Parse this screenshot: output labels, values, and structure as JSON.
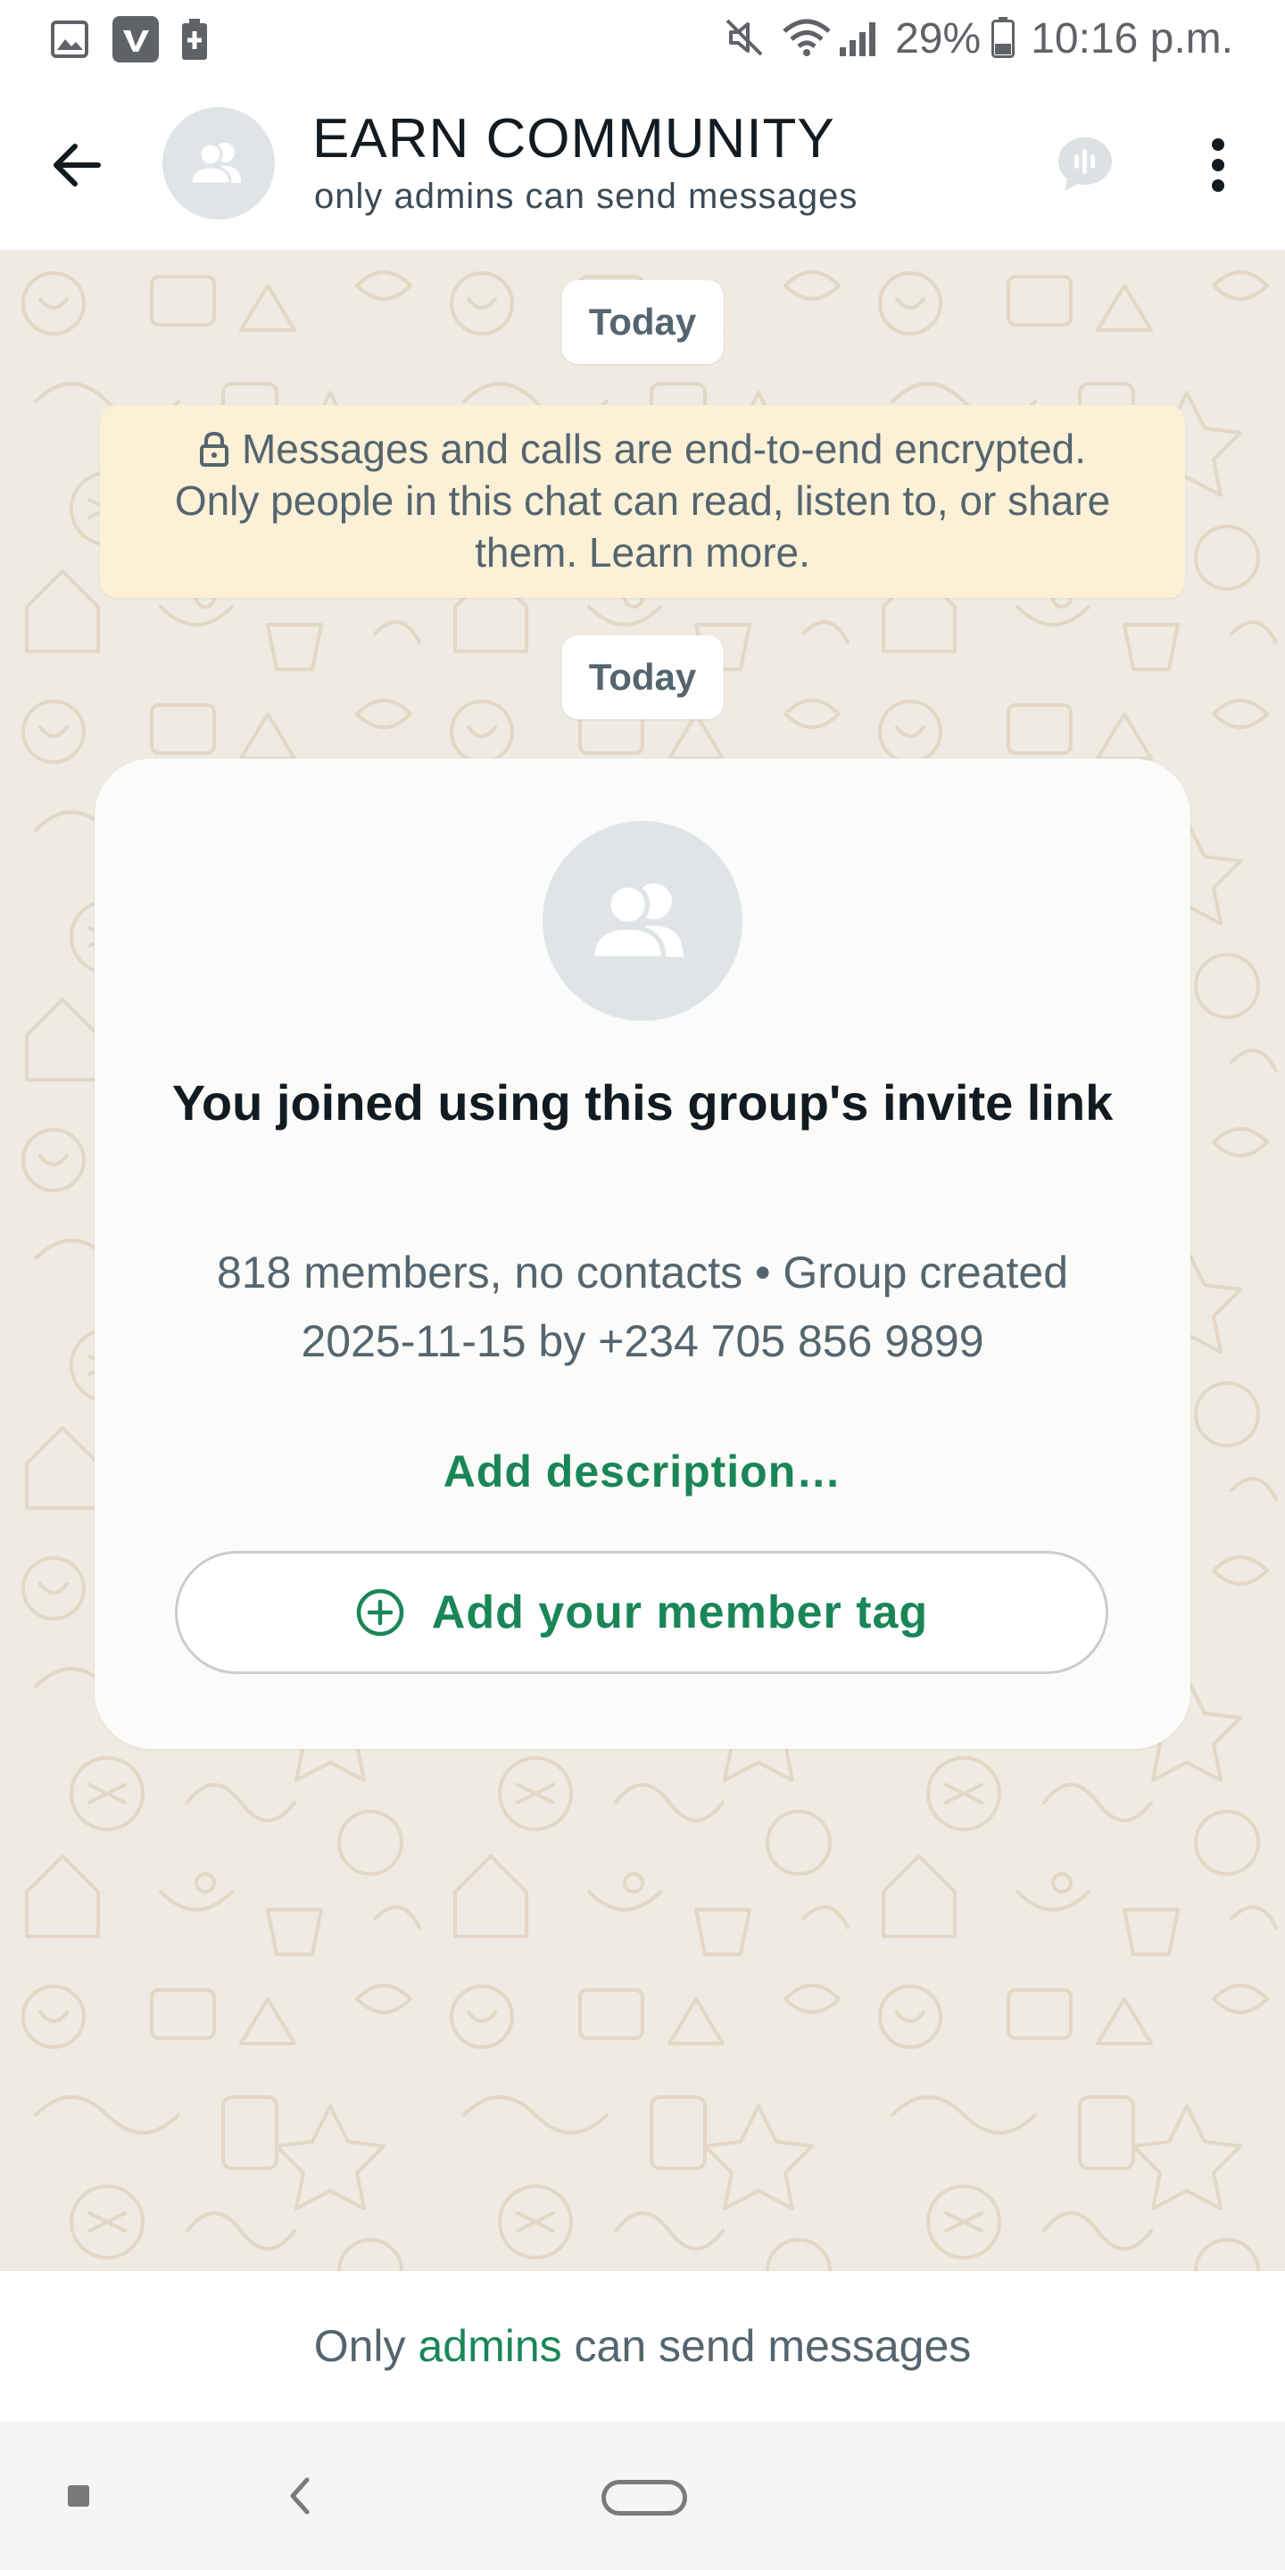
{
  "status_bar": {
    "left_icons": [
      "gallery-icon",
      "vimeo-icon",
      "battery-saver-icon"
    ],
    "right_icons": [
      "mute-icon",
      "wifi-icon",
      "signal-icon",
      "battery-icon"
    ],
    "battery_percent": "29%",
    "time": "10:16 p.m."
  },
  "header": {
    "title": "EARN COMMUNITY",
    "subtitle": "only admins can send messages",
    "icons": [
      "back-arrow-icon",
      "group-avatar-icon",
      "voice-chat-icon",
      "more-vert-icon"
    ]
  },
  "chat": {
    "date_chip_1": "Today",
    "encryption_notice": {
      "line1": "Messages and calls are end-to-end encrypted.",
      "line2": "Only people in this chat can read, listen to, or share",
      "line3": "them. Learn more."
    },
    "date_chip_2": "Today",
    "join_card": {
      "title": "You joined using this group's invite link",
      "info": "818 members, no contacts • Group created 2025-11-15 by +234 705 856 9899",
      "add_description": "Add description…",
      "member_tag_button": "Add your member tag"
    }
  },
  "footer": {
    "notice_prefix": "Only",
    "notice_link": "admins",
    "notice_suffix": "can send messages"
  },
  "nav_bar": {
    "icons": [
      "recents-icon",
      "back-icon",
      "home-icon"
    ]
  },
  "colors": {
    "accent_green": "#1a8658",
    "chat_background": "#efeae2",
    "encryption_bg": "#fcf0d6",
    "avatar_bg": "#dfe5e7"
  }
}
